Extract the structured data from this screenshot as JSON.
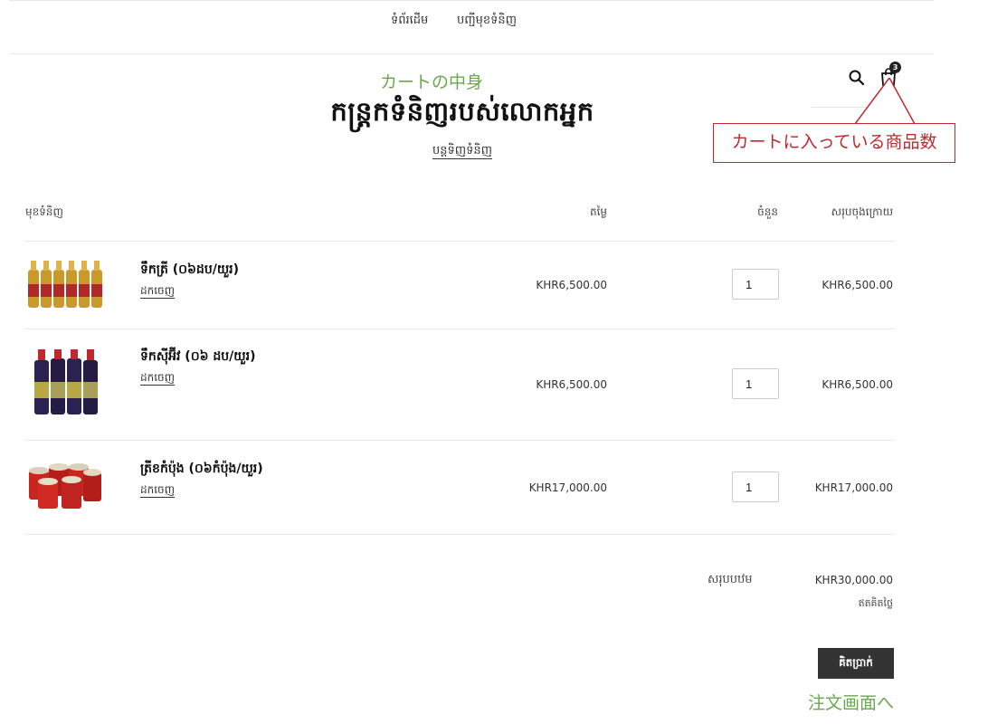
{
  "nav": {
    "items": [
      {
        "label": "ទំព័រដើម"
      },
      {
        "label": "បញ្ជីមុខទំនិញ"
      }
    ]
  },
  "header": {
    "annotation": "カートの中身",
    "title": "កន្ត្រកទំនិញរបស់លោកអ្នក",
    "continue_shopping": "បន្តទិញទំនិញ",
    "cart_count": "3",
    "cart_count_annotation": "カートに入っている商品数"
  },
  "table": {
    "headers": {
      "product": "មុខទំនិញ",
      "price": "តម្លៃ",
      "quantity": "ចំនួន",
      "total": "សរុបចុងក្រោយ"
    },
    "rows": [
      {
        "title": "ទឹកត្រី (០៦ដប/យួរ)",
        "remove": "ដកចេញ",
        "price": "KHR6,500.00",
        "quantity": "1",
        "total": "KHR6,500.00"
      },
      {
        "title": "ទឹកស៊ីអ៊ីវ (០៦ ដប/យួរ)",
        "remove": "ដកចេញ",
        "price": "KHR6,500.00",
        "quantity": "1",
        "total": "KHR6,500.00"
      },
      {
        "title": "ត្រីខកំប៉ុង (០៦កំប៉ុង/យួរ)",
        "remove": "ដកចេញ",
        "price": "KHR17,000.00",
        "quantity": "1",
        "total": "KHR17,000.00"
      }
    ]
  },
  "summary": {
    "subtotal_label": "សរុបបឋម",
    "subtotal_value": "KHR30,000.00",
    "tax_note": "ឥតគិតថ្លៃ",
    "checkout_label": "គិតប្រាក់",
    "checkout_annotation": "注文画面へ"
  },
  "colors": {
    "annotation_green": "#6aa84f",
    "annotation_red": "#c0282d",
    "button_dark": "#333333"
  }
}
